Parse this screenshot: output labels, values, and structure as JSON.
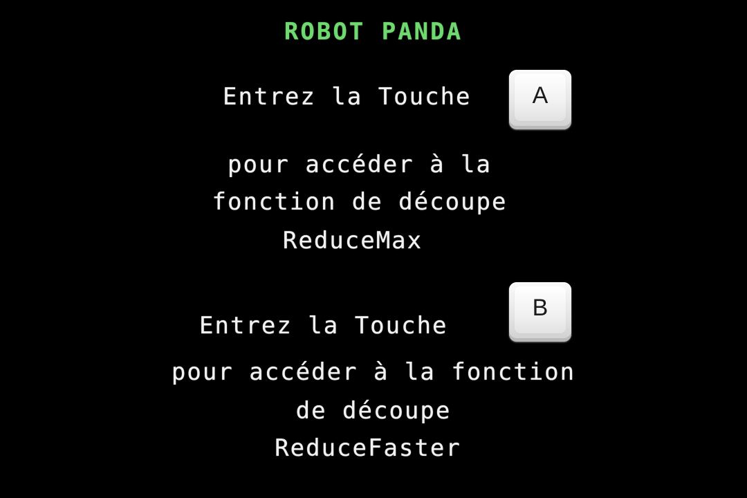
{
  "title": "ROBOT PANDA",
  "section_a": {
    "prompt": "Entrez la Touche",
    "key": "A",
    "lines": [
      "pour accéder à la",
      "fonction de découpe",
      "ReduceMax"
    ]
  },
  "section_b": {
    "prompt": "Entrez la Touche",
    "key": "B",
    "lines": [
      "pour accéder à la fonction",
      "de découpe",
      "ReduceFaster"
    ]
  },
  "colors": {
    "background": "#000000",
    "title": "#6fd86f",
    "text": "#f2f2f2"
  }
}
